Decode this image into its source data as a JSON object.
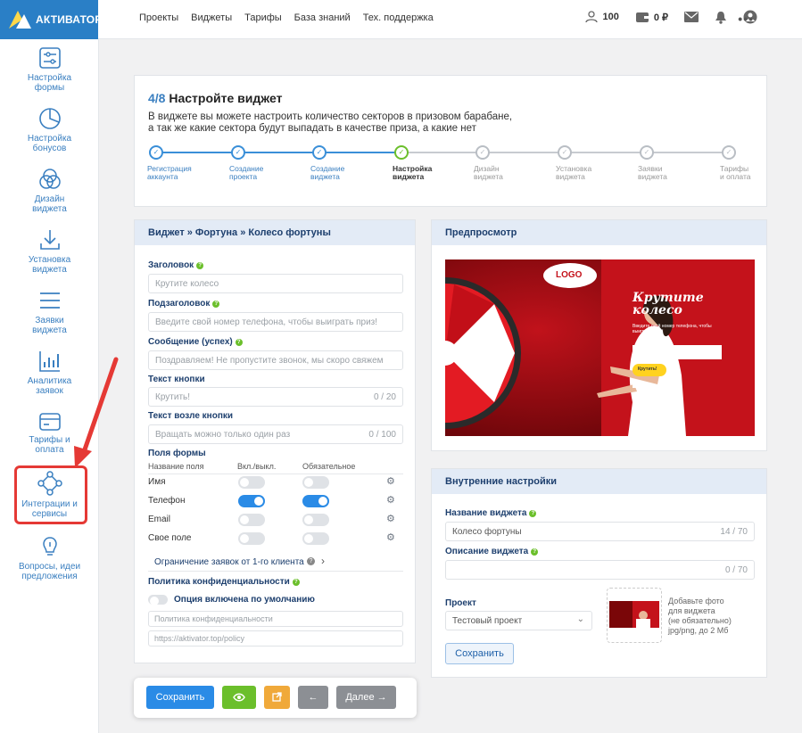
{
  "brand": {
    "name": "АКТИВАТОР"
  },
  "topnav": [
    "Проекты",
    "Виджеты",
    "Тарифы",
    "База знаний",
    "Тех. поддержка"
  ],
  "topright": {
    "users": "100",
    "balance": "0 ₽"
  },
  "sidebar": [
    {
      "label": "Настройка формы",
      "icon": "form-settings-icon"
    },
    {
      "label": "Настройка бонусов",
      "icon": "pie-icon"
    },
    {
      "label": "Дизайн виджета",
      "icon": "design-icon"
    },
    {
      "label": "Установка виджета",
      "icon": "download-icon"
    },
    {
      "label": "Заявки виджета",
      "icon": "list-icon"
    },
    {
      "label": "Аналитика заявок",
      "icon": "chart-icon"
    },
    {
      "label": "Тарифы и оплата",
      "icon": "card-icon"
    },
    {
      "label": "Интеграции и сервисы",
      "icon": "integrations-icon"
    },
    {
      "label": "Вопросы, идеи предложения",
      "icon": "bulb-icon"
    }
  ],
  "step": {
    "number": "4/8",
    "title": "Настройте виджет",
    "desc1": "В виджете вы можете настроить количество секторов в призовом барабане,",
    "desc2": "а так же какие сектора будут выпадать в качестве приза, а какие нет"
  },
  "steps": [
    {
      "l1": "Регистрация",
      "l2": "аккаунта",
      "state": "done"
    },
    {
      "l1": "Создание",
      "l2": "проекта",
      "state": "done"
    },
    {
      "l1": "Создание",
      "l2": "виджета",
      "state": "done"
    },
    {
      "l1": "Настройка",
      "l2": "виджета",
      "state": "current"
    },
    {
      "l1": "Дизайн",
      "l2": "виджета",
      "state": "todo"
    },
    {
      "l1": "Установка",
      "l2": "виджета",
      "state": "todo"
    },
    {
      "l1": "Заявки",
      "l2": "виджета",
      "state": "todo"
    },
    {
      "l1": "Тарифы",
      "l2": "и оплата",
      "state": "todo"
    }
  ],
  "form": {
    "breadcrumb": "Виджет » Фортуна » Колесо фортуны",
    "title_label": "Заголовок",
    "title_placeholder": "Крутите колесо",
    "subtitle_label": "Подзаголовок",
    "subtitle_placeholder": "Введите свой номер телефона, чтобы выиграть приз!",
    "success_label": "Сообщение (успех)",
    "success_placeholder": "Поздравляем! Не пропустите звонок, мы скоро свяжем",
    "button_label": "Текст кнопки",
    "button_placeholder": "Крутить!",
    "button_count": "0 / 20",
    "near_label": "Текст возле кнопки",
    "near_placeholder": "Вращать можно только один раз",
    "near_count": "0 / 100",
    "fields_label": "Поля формы",
    "col_name": "Название поля",
    "col_on": "Вкл./выкл.",
    "col_req": "Обязательное",
    "fields": [
      {
        "name": "Имя",
        "on": false,
        "req": false
      },
      {
        "name": "Телефон",
        "on": true,
        "req": true
      },
      {
        "name": "Email",
        "on": false,
        "req": false
      },
      {
        "name": "Свое поле",
        "on": false,
        "req": false
      }
    ],
    "limit": "Ограничение заявок от 1-го клиента",
    "privacy_label": "Политика конфиденциальности",
    "privacy_toggle": "Опция включена по умолчанию",
    "privacy_placeholder": "Политика конфиденциальности",
    "privacy_url": "https://aktivator.top/policy"
  },
  "preview": {
    "title": "Предпросмотр",
    "logo": "LOGO",
    "headline1": "Крутите",
    "headline2": "колесо",
    "sub": "Введите свой номер телефона, чтобы выиграть приз!",
    "btn": "Крутить!"
  },
  "internal": {
    "title": "Внутренние настройки",
    "name_label": "Название виджета",
    "name_value": "Колесо фортуны",
    "name_count": "14 / 70",
    "desc_label": "Описание виджета",
    "desc_count": "0 / 70",
    "project_label": "Проект",
    "project_value": "Тестовый проект",
    "photo_hint1": "Добавьте фото",
    "photo_hint2": "для виджета",
    "photo_hint3": "(не обязательно)",
    "photo_hint4": "jpg/png, до 2 Мб",
    "save": "Сохранить"
  },
  "bottom": {
    "save": "Сохранить",
    "next": "Далее →"
  },
  "colors": {
    "primary": "#2a8be6",
    "green": "#6bbf2b",
    "orange": "#f0a93a",
    "gray": "#8c8f94",
    "red": "#e53935"
  }
}
